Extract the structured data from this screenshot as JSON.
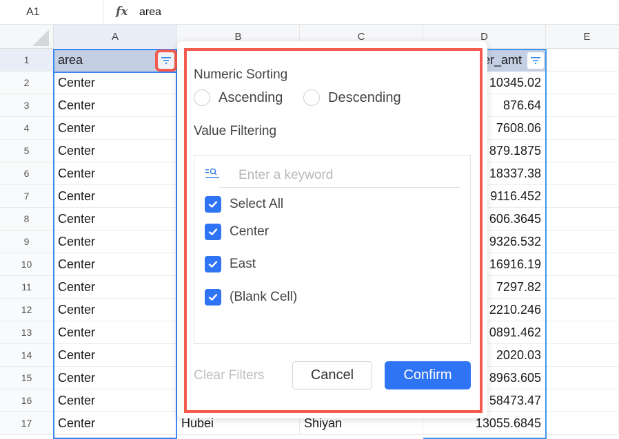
{
  "formula_bar": {
    "cell_ref": "A1",
    "fx_label": "fx",
    "value": "area"
  },
  "columns": [
    "A",
    "B",
    "C",
    "D",
    "E"
  ],
  "rows": [
    {
      "num": "1",
      "a": "area",
      "b": "",
      "c": "",
      "d": "er_amt"
    },
    {
      "num": "2",
      "a": "Center",
      "b": "",
      "c": "",
      "d": "10345.02"
    },
    {
      "num": "3",
      "a": "Center",
      "b": "",
      "c": "",
      "d": "876.64"
    },
    {
      "num": "4",
      "a": "Center",
      "b": "",
      "c": "",
      "d": "7608.06"
    },
    {
      "num": "5",
      "a": "Center",
      "b": "",
      "c": "",
      "d": "879.1875"
    },
    {
      "num": "6",
      "a": "Center",
      "b": "",
      "c": "",
      "d": "18337.38"
    },
    {
      "num": "7",
      "a": "Center",
      "b": "",
      "c": "",
      "d": "9116.452"
    },
    {
      "num": "8",
      "a": "Center",
      "b": "",
      "c": "",
      "d": "606.3645"
    },
    {
      "num": "9",
      "a": "Center",
      "b": "",
      "c": "",
      "d": "9326.532"
    },
    {
      "num": "10",
      "a": "Center",
      "b": "",
      "c": "",
      "d": "16916.19"
    },
    {
      "num": "11",
      "a": "Center",
      "b": "",
      "c": "",
      "d": "7297.82"
    },
    {
      "num": "12",
      "a": "Center",
      "b": "",
      "c": "",
      "d": "2210.246"
    },
    {
      "num": "13",
      "a": "Center",
      "b": "",
      "c": "",
      "d": "0891.462"
    },
    {
      "num": "14",
      "a": "Center",
      "b": "",
      "c": "",
      "d": "2020.03"
    },
    {
      "num": "15",
      "a": "Center",
      "b": "",
      "c": "",
      "d": "8963.605"
    },
    {
      "num": "16",
      "a": "Center",
      "b": "",
      "c": "",
      "d": "58473.47"
    },
    {
      "num": "17",
      "a": "Center",
      "b": "Hubei",
      "c": "Shiyan",
      "d": "13055.6845"
    }
  ],
  "filter_popup": {
    "sorting_title": "Numeric Sorting",
    "ascending_label": "Ascending",
    "descending_label": "Descending",
    "filtering_title": "Value Filtering",
    "search_placeholder": "Enter a keyword",
    "options": [
      {
        "label": "Select All",
        "checked": true
      },
      {
        "label": "Center",
        "checked": true
      },
      {
        "label": "East",
        "checked": true
      },
      {
        "label": "(Blank Cell)",
        "checked": true
      }
    ],
    "clear_label": "Clear Filters",
    "cancel_label": "Cancel",
    "confirm_label": "Confirm"
  },
  "colors": {
    "accent": "#2f74f4",
    "highlight": "#f45a4d",
    "selection": "#3b86f0"
  }
}
